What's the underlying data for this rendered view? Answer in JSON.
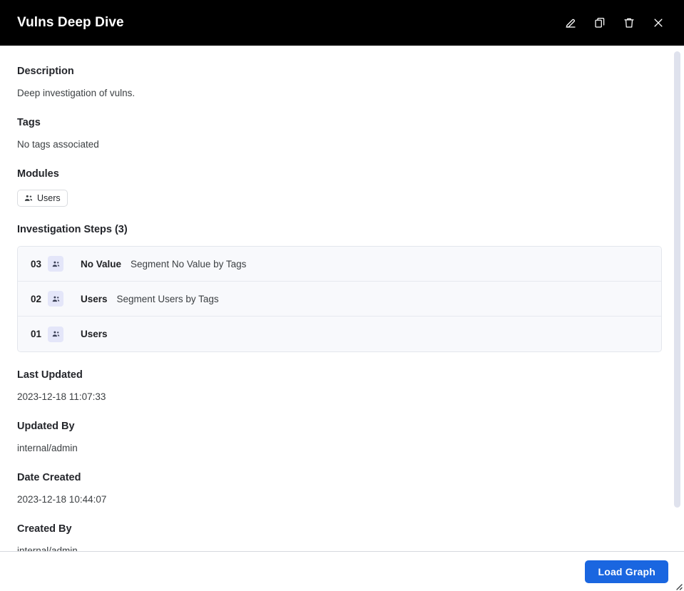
{
  "header": {
    "title": "Vulns Deep Dive",
    "actions": [
      {
        "name": "edit-icon",
        "label": "Edit"
      },
      {
        "name": "duplicate-icon",
        "label": "Duplicate"
      },
      {
        "name": "delete-icon",
        "label": "Delete"
      },
      {
        "name": "close-icon",
        "label": "Close"
      }
    ]
  },
  "details": {
    "description_label": "Description",
    "description_value": "Deep investigation of vulns.",
    "tags_label": "Tags",
    "tags_value": "No tags associated",
    "modules_label": "Modules",
    "modules": [
      {
        "label": "Users",
        "icon": "group-icon"
      }
    ],
    "steps_label": "Investigation Steps (3)",
    "steps": [
      {
        "number": "03",
        "icon": "group-icon",
        "title": "No Value",
        "description": "Segment No Value by Tags"
      },
      {
        "number": "02",
        "icon": "group-icon",
        "title": "Users",
        "description": "Segment Users by Tags"
      },
      {
        "number": "01",
        "icon": "group-icon",
        "title": "Users",
        "description": ""
      }
    ],
    "last_updated_label": "Last Updated",
    "last_updated_value": "2023-12-18 11:07:33",
    "updated_by_label": "Updated By",
    "updated_by_value": "internal/admin",
    "date_created_label": "Date Created",
    "date_created_value": "2023-12-18 10:44:07",
    "created_by_label": "Created By",
    "created_by_value": "internal/admin"
  },
  "footer": {
    "primary_button": "Load Graph"
  },
  "colors": {
    "header_bg": "#000000",
    "accent": "#1a66e0",
    "step_row_bg": "#f8f9fc",
    "badge_bg": "#e4e6f9",
    "scrollbar_thumb": "#dfe2ed"
  }
}
